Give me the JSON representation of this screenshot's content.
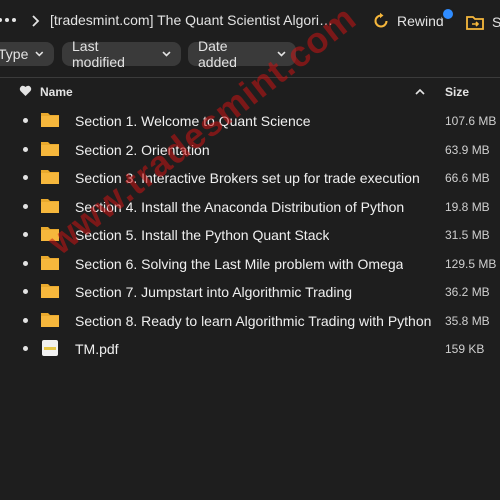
{
  "topbar": {
    "breadcrumb": "[tradesmint.com] The Quant Scientist Algorith...",
    "rewind_label": "Rewind",
    "share_label": "S"
  },
  "filters": {
    "type": "Type",
    "last_modified": "Last modified",
    "date_added": "Date added"
  },
  "columns": {
    "name": "Name",
    "size": "Size"
  },
  "files": [
    {
      "name": "Section 1. Welcome to Quant Science",
      "size": "107.6 MB",
      "kind": "folder"
    },
    {
      "name": "Section 2. Orientation",
      "size": "63.9 MB",
      "kind": "folder"
    },
    {
      "name": "Section 3. Interactive Brokers set up for trade execution",
      "size": "66.6 MB",
      "kind": "folder"
    },
    {
      "name": "Section 4. Install the Anaconda Distribution of Python",
      "size": "19.8 MB",
      "kind": "folder"
    },
    {
      "name": "Section 5. Install the Python Quant Stack",
      "size": "31.5 MB",
      "kind": "folder"
    },
    {
      "name": "Section 6. Solving the Last Mile problem with Omega",
      "size": "129.5 MB",
      "kind": "folder"
    },
    {
      "name": "Section 7. Jumpstart into Algorithmic Trading",
      "size": "36.2 MB",
      "kind": "folder"
    },
    {
      "name": "Section 8. Ready to learn Algorithmic Trading with Python",
      "size": "35.8 MB",
      "kind": "folder"
    },
    {
      "name": "TM.pdf",
      "size": "159 KB",
      "kind": "file"
    }
  ],
  "watermark": "www.tradesmint.com",
  "colors": {
    "background": "#1e1e1e",
    "folder": "#f6b73c",
    "accent_dot": "#2f8cff",
    "rewind_icon": "#f6b73c",
    "watermark": "#c81414"
  }
}
